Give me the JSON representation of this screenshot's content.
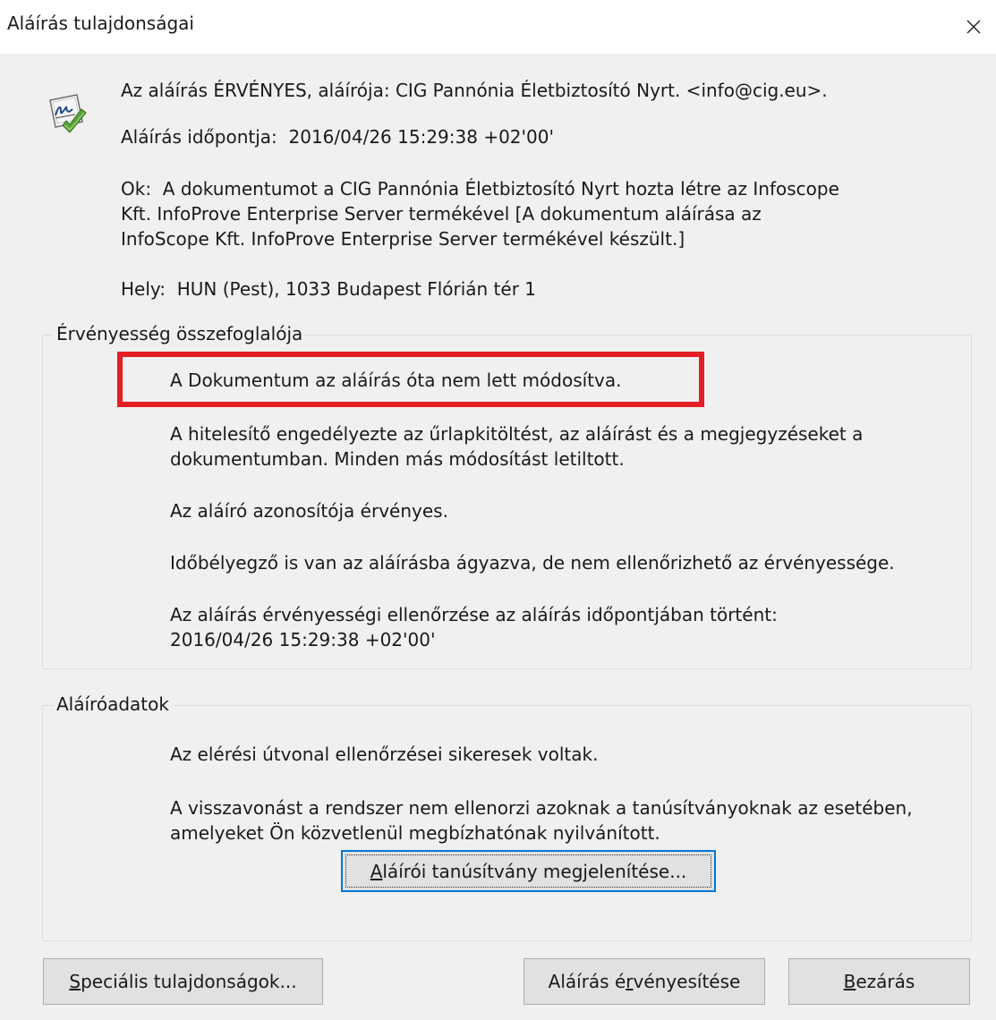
{
  "window": {
    "title": "Aláírás tulajdonságai",
    "close_icon": "×"
  },
  "summary": {
    "status_line": "Az aláírás ÉRVÉNYES, aláírója: CIG Pannónia Életbiztosító Nyrt. <info@cig.eu>.",
    "time_line": "Aláírás időpontja:  2016/04/26 15:29:38 +02'00'",
    "reason_lines": [
      "Ok:  A dokumentumot a CIG Pannónia Életbiztosító Nyrt hozta létre az Infoscope",
      "Kft. InfoProve Enterprise Server termékével [A dokumentum aláírása az",
      "InfoScope Kft. InfoProve Enterprise Server termékével készült.]"
    ],
    "location_line": "Hely:  HUN (Pest), 1033 Budapest Flórián tér 1"
  },
  "validity": {
    "title": "Érvényesség összefoglalója",
    "not_modified": "A Dokumentum az aláírás óta nem lett módosítva.",
    "permissions_lines": [
      "A hitelesítő engedélyezte az űrlapkitöltést, az aláírást és a megjegyzéseket a",
      "dokumentumban. Minden más módosítást letiltott."
    ],
    "identity_valid": "Az aláíró azonosítója érvényes.",
    "timestamp_note": "Időbélyegző is van az aláírásba ágyazva, de nem ellenőrizhető az érvényessége.",
    "check_time_lines": [
      "Az aláírás érvényességi ellenőrzése az aláírás időpontjában történt:",
      "2016/04/26 15:29:38 +02'00'"
    ]
  },
  "signer": {
    "title": "Aláíróadatok",
    "path_ok": "Az elérési útvonal ellenőrzései sikeresek voltak.",
    "revocation_lines": [
      "A visszavonást a rendszer nem ellenorzi azoknak a tanúsítványoknak az esetében,",
      "amelyeket Ön közvetlenül megbízhatónak nyilvánított."
    ],
    "show_cert_button": {
      "mnemonic": "A",
      "rest": "láírói tanúsítvány megjelenítése..."
    }
  },
  "buttons": {
    "advanced": {
      "mnemonic": "S",
      "rest": "peciális tulajdonságok..."
    },
    "validate": {
      "before": "Aláírás é",
      "mnemonic": "r",
      "after": "vényesítése"
    },
    "close": {
      "mnemonic": "B",
      "rest": "ezárás"
    }
  },
  "colors": {
    "highlight": "#e31e24",
    "default_button_border": "#0078d7",
    "dialog_bg": "#f0f0f0"
  },
  "icons": {
    "signature": "signature-valid-icon",
    "close": "close-icon"
  }
}
